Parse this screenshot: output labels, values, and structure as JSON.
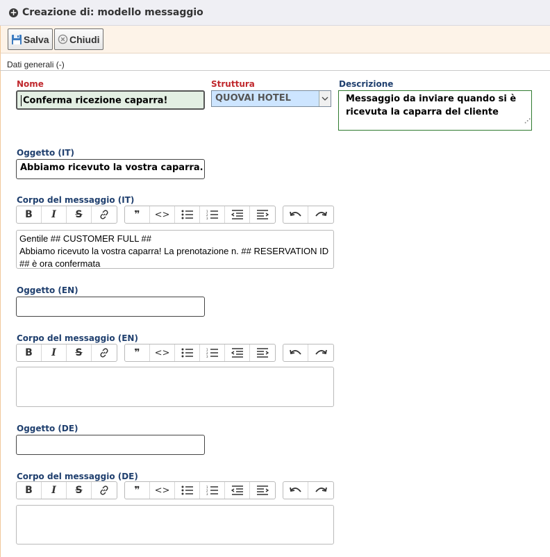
{
  "header": {
    "title": "Creazione di: modello messaggio"
  },
  "toolbar": {
    "save_label": "Salva",
    "close_label": "Chiudi"
  },
  "section": {
    "label": "Dati generali (-)"
  },
  "form": {
    "nome": {
      "label": "Nome",
      "value": "Conferma ricezione caparra!"
    },
    "struttura": {
      "label": "Struttura",
      "value": "QUOVAI HOTEL"
    },
    "descrizione": {
      "label": "Descrizione",
      "value": "Messaggio da inviare quando si è ricevuta la caparra del cliente"
    },
    "oggetto_it": {
      "label": "Oggetto (IT)",
      "value": "Abbiamo ricevuto la vostra caparra..."
    },
    "corpo_it": {
      "label": "Corpo del messaggio (IT)",
      "line1": "Gentile ## CUSTOMER FULL ##",
      "line2": "Abbiamo ricevuto la vostra caparra! La prenotazione n. ## RESERVATION ID ## è ora confermata"
    },
    "oggetto_en": {
      "label": "Oggetto (EN)",
      "value": ""
    },
    "corpo_en": {
      "label": "Corpo del messaggio (EN)",
      "value": ""
    },
    "oggetto_de": {
      "label": "Oggetto (DE)",
      "value": ""
    },
    "corpo_de": {
      "label": "Corpo del messaggio (DE)",
      "value": ""
    }
  },
  "editor_buttons": [
    "B",
    "I",
    "strikethrough",
    "link",
    "quote",
    "code",
    "bullet-list",
    "numbered-list",
    "outdent",
    "indent",
    "undo",
    "redo"
  ],
  "colors": {
    "required": "#c0282d",
    "label": "#1f3f6e",
    "toolbar_bg": "#fdf3e8",
    "select_bg": "#cde5ff"
  }
}
